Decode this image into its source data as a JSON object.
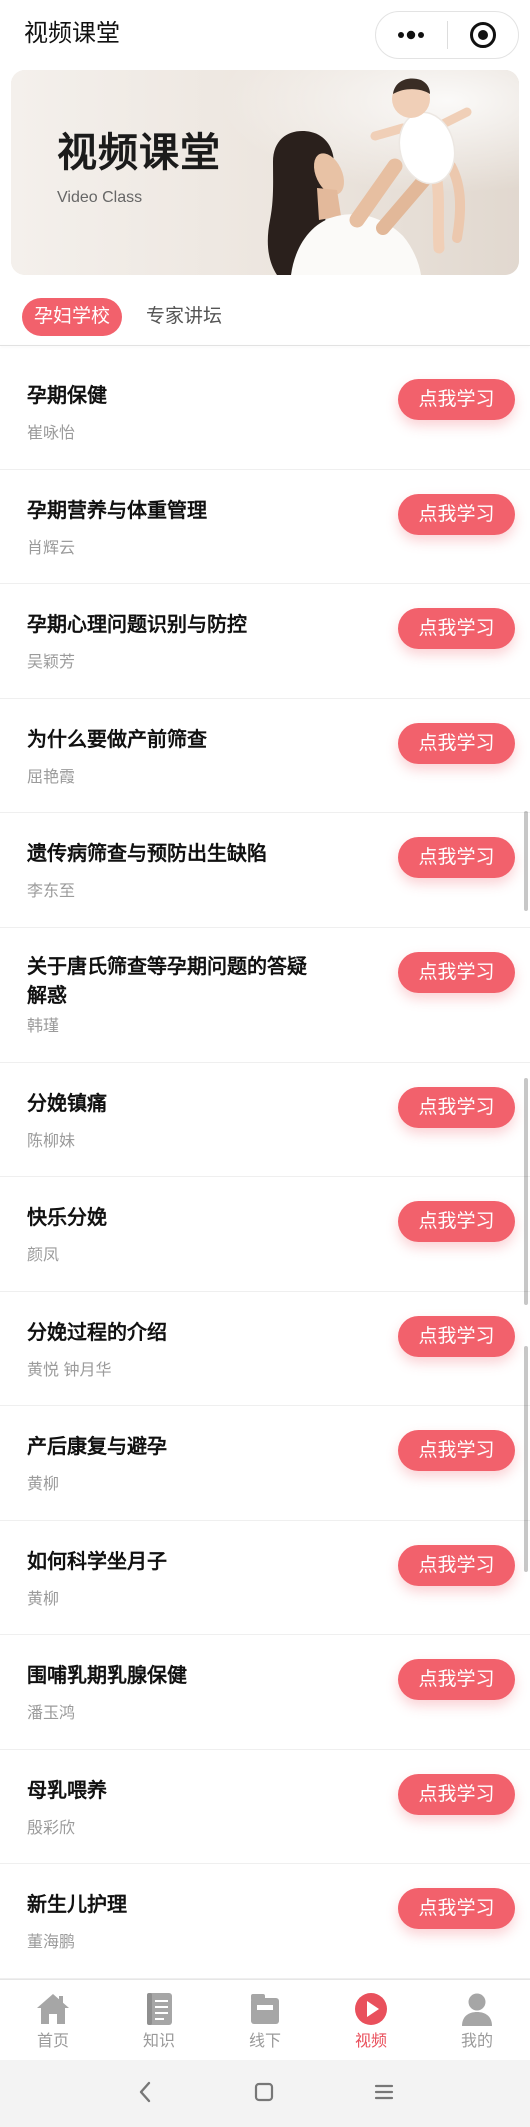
{
  "app": {
    "title": "视频课堂"
  },
  "capsule": {
    "more_icon": "more-dots-icon",
    "close_icon": "target-circle-icon"
  },
  "banner": {
    "title": "视频课堂",
    "subtitle": "Video Class"
  },
  "tabs": [
    {
      "label": "孕妇学校",
      "active": true
    },
    {
      "label": "专家讲坛",
      "active": false
    }
  ],
  "course_list": {
    "button_label": "点我学习",
    "items": [
      {
        "title": "孕期保健",
        "lecturer": "崔咏怡"
      },
      {
        "title": "孕期营养与体重管理",
        "lecturer": "肖辉云"
      },
      {
        "title": "孕期心理问题识别与防控",
        "lecturer": "吴颖芳"
      },
      {
        "title": "为什么要做产前筛查",
        "lecturer": "屈艳霞"
      },
      {
        "title": "遗传病筛查与预防出生缺陷",
        "lecturer": "李东至"
      },
      {
        "title": "关于唐氏筛查等孕期问题的答疑解惑",
        "lecturer": "韩瑾"
      },
      {
        "title": "分娩镇痛",
        "lecturer": "陈柳妹"
      },
      {
        "title": "快乐分娩",
        "lecturer": "颜凤"
      },
      {
        "title": "分娩过程的介绍",
        "lecturer": "黄悦 钟月华"
      },
      {
        "title": "产后康复与避孕",
        "lecturer": "黄柳"
      },
      {
        "title": "如何科学坐月子",
        "lecturer": "黄柳"
      },
      {
        "title": "围哺乳期乳腺保健",
        "lecturer": "潘玉鸿"
      },
      {
        "title": "母乳喂养",
        "lecturer": "殷彩欣"
      },
      {
        "title": "新生儿护理",
        "lecturer": "董海鹏"
      }
    ]
  },
  "tabbar": [
    {
      "label": "首页",
      "icon": "home-icon",
      "active": false
    },
    {
      "label": "知识",
      "icon": "knowledge-icon",
      "active": false
    },
    {
      "label": "线下",
      "icon": "offline-icon",
      "active": false
    },
    {
      "label": "视频",
      "icon": "video-icon",
      "active": true
    },
    {
      "label": "我的",
      "icon": "profile-icon",
      "active": false
    }
  ],
  "system_nav": {
    "icons": [
      "back-icon",
      "home-square-icon",
      "menu-icon"
    ]
  },
  "colors": {
    "accent": "#f2616c",
    "active_tab": "#e9505c",
    "title_text": "#111111",
    "secondary_text": "#9b9b9b",
    "icon_gray": "#a6a6a6",
    "nav_bar_bg": "#f3f3f3"
  }
}
